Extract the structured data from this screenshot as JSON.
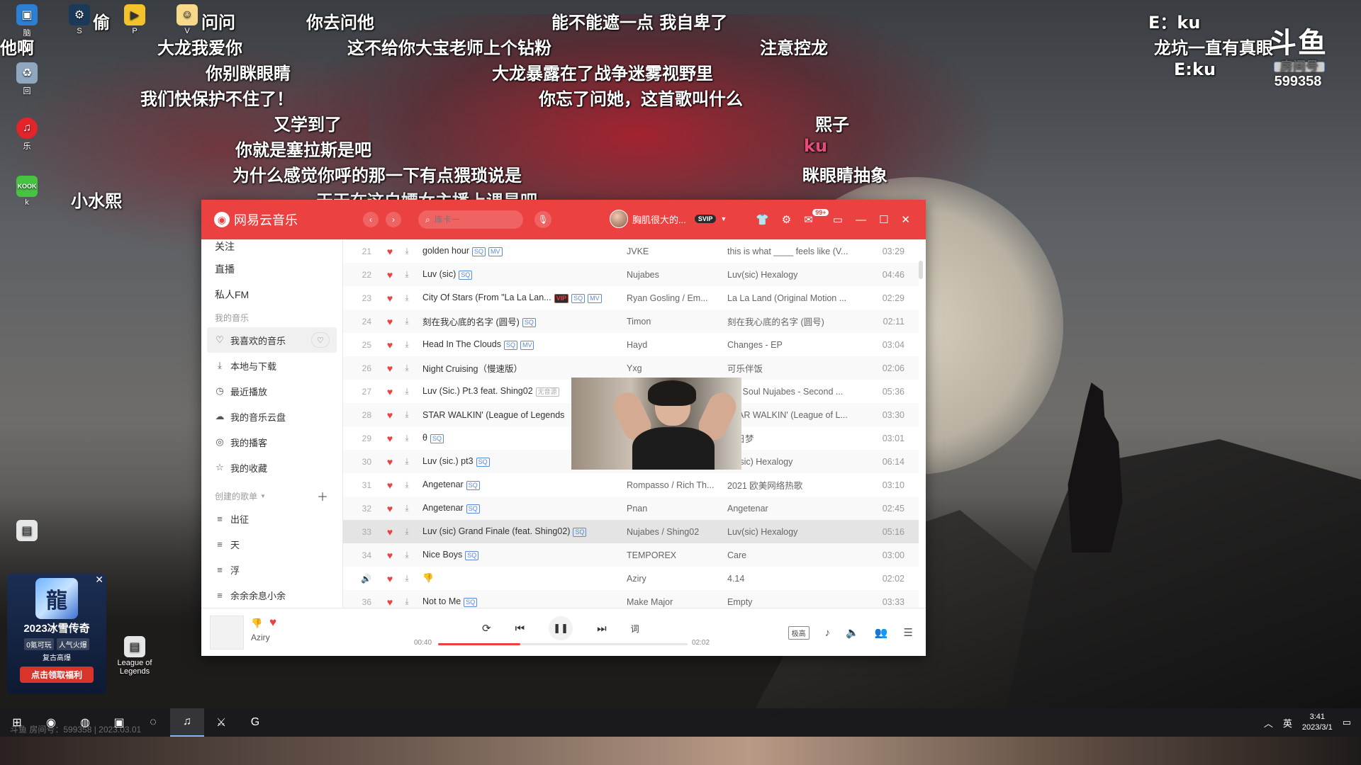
{
  "desktop": {
    "icons": [
      {
        "label": "脑"
      },
      {
        "label": "回"
      },
      {
        "label": "乐"
      },
      {
        "label": "k"
      },
      {
        "label": "S"
      },
      {
        "label": "P"
      },
      {
        "label": "V"
      },
      {
        "label": "League of Legends"
      }
    ]
  },
  "danmaku": [
    "偷",
    "问问",
    "你去问他",
    "能不能遮一点 我自卑了",
    "E：ku",
    "他啊",
    "大龙我爱你",
    "这不给你大宝老师上个钻粉",
    "注意控龙",
    "龙坑一直有真眼",
    "你别眯眼睛",
    "大龙暴露在了战争迷雾视野里",
    "E:ku",
    "我们快保护不住了！",
    "你忘了问她，这首歌叫什么",
    "又学到了",
    "熙子",
    "你就是塞拉斯是吧",
    "ku",
    "为什么感觉你呼的那一下有点猥琐说是",
    "眯眼睛抽象",
    "小水熙",
    "天天在这白嫖女主播上课是吧"
  ],
  "room": {
    "logo": "斗鱼",
    "tag": "房间号",
    "number": "599358"
  },
  "app": {
    "name": "网易云音乐",
    "search_placeholder": "库卡一",
    "user_name": "胸肌很大的...",
    "vip_badge": "SVIP",
    "mail_badge": "99+",
    "sidebar": {
      "top_items": [
        "关注",
        "直播",
        "私人FM"
      ],
      "my_music_header": "我的音乐",
      "my_music": [
        {
          "label": "我喜欢的音乐",
          "icon": "heart-icon"
        },
        {
          "label": "本地与下载",
          "icon": "download-icon"
        },
        {
          "label": "最近播放",
          "icon": "clock-icon"
        },
        {
          "label": "我的音乐云盘",
          "icon": "cloud-icon"
        },
        {
          "label": "我的播客",
          "icon": "podcast-icon"
        },
        {
          "label": "我的收藏",
          "icon": "collection-icon"
        }
      ],
      "created_header": "创建的歌单",
      "playlists": [
        "出征",
        "天",
        "浮",
        "余余余息小余"
      ]
    },
    "tracks": [
      {
        "num": "21",
        "title": "golden hour",
        "tags": [
          "SQ",
          "MV"
        ],
        "artist": "JVKE",
        "album": "this is what ____ feels like (V...",
        "duration": "03:29"
      },
      {
        "num": "22",
        "title": "Luv (sic)",
        "tags": [
          "SQ"
        ],
        "artist": "Nujabes",
        "album": "Luv(sic) Hexalogy",
        "duration": "04:46"
      },
      {
        "num": "23",
        "title": "City Of Stars (From \"La La Lan...",
        "tags": [
          "VIP",
          "SQ",
          "MV"
        ],
        "artist": "Ryan Gosling / Em...",
        "album": "La La Land (Original Motion ...",
        "duration": "02:29"
      },
      {
        "num": "24",
        "title": "刻在我心底的名字 (圆号)",
        "tags": [
          "SQ"
        ],
        "artist": "Timon",
        "album": "刻在我心底的名字 (圆号)",
        "duration": "02:11"
      },
      {
        "num": "25",
        "title": "Head In The Clouds",
        "tags": [
          "SQ",
          "MV"
        ],
        "artist": "Hayd",
        "album": "Changes - EP",
        "duration": "03:04"
      },
      {
        "num": "26",
        "title": "Night Cruising（慢速版）",
        "tags": [],
        "artist": "Yxg",
        "album": "可乐伴饭",
        "duration": "02:06"
      },
      {
        "num": "27",
        "title": "Luv (Sic.) Pt.3 feat. Shing02",
        "tags": [
          "无音源"
        ],
        "artist": "",
        "album": "ree Soul Nujabes - Second ...",
        "duration": "05:36"
      },
      {
        "num": "28",
        "title": "STAR WALKIN' (League of Legends",
        "tags": [],
        "artist": "",
        "album": "STAR WALKIN' (League of L...",
        "duration": "03:30"
      },
      {
        "num": "29",
        "title": "θ",
        "tags": [
          "SQ"
        ],
        "artist": "",
        "album": "白日梦",
        "duration": "03:01"
      },
      {
        "num": "30",
        "title": "Luv (sic.) pt3",
        "tags": [
          "SQ"
        ],
        "artist": "",
        "album": "uv(sic) Hexalogy",
        "duration": "06:14"
      },
      {
        "num": "31",
        "title": "Angetenar",
        "tags": [
          "SQ"
        ],
        "artist": "Rompasso / Rich Th...",
        "album": "2021 欧美网络热歌",
        "duration": "03:10"
      },
      {
        "num": "32",
        "title": "Angetenar",
        "tags": [
          "SQ"
        ],
        "artist": "Pnan",
        "album": "Angetenar",
        "duration": "02:45"
      },
      {
        "num": "33",
        "title": "Luv (sic) Grand Finale (feat. Shing02)",
        "tags": [
          "SQ"
        ],
        "artist": "Nujabes / Shing02",
        "album": "Luv(sic) Hexalogy",
        "duration": "05:16"
      },
      {
        "num": "34",
        "title": "Nice Boys",
        "tags": [
          "SQ"
        ],
        "artist": "TEMPOREX",
        "album": "Care",
        "duration": "03:00"
      },
      {
        "num": "",
        "title": "👎",
        "tags": [],
        "artist": "Aziry",
        "album": "4.14",
        "duration": "02:02"
      },
      {
        "num": "36",
        "title": "Not to Me",
        "tags": [
          "SQ"
        ],
        "artist": "Make Major",
        "album": "Empty",
        "duration": "03:33"
      }
    ],
    "player": {
      "title": "👎",
      "artist": "Aziry",
      "current_time": "00:40",
      "total_time": "02:02",
      "progress": 0.33,
      "quality": "极高",
      "lyrics_label": "词"
    }
  },
  "ad": {
    "title": "2023冰雪传奇",
    "chips": [
      "0氪可玩",
      "人气火爆"
    ],
    "sub": "复古高爆",
    "cta": "点击领取福利"
  },
  "taskbar": {
    "overlay": "斗鱼 房间号：599358 | 2023.03.01",
    "ime": "英",
    "time": "3:41",
    "date": "2023/3/1"
  }
}
